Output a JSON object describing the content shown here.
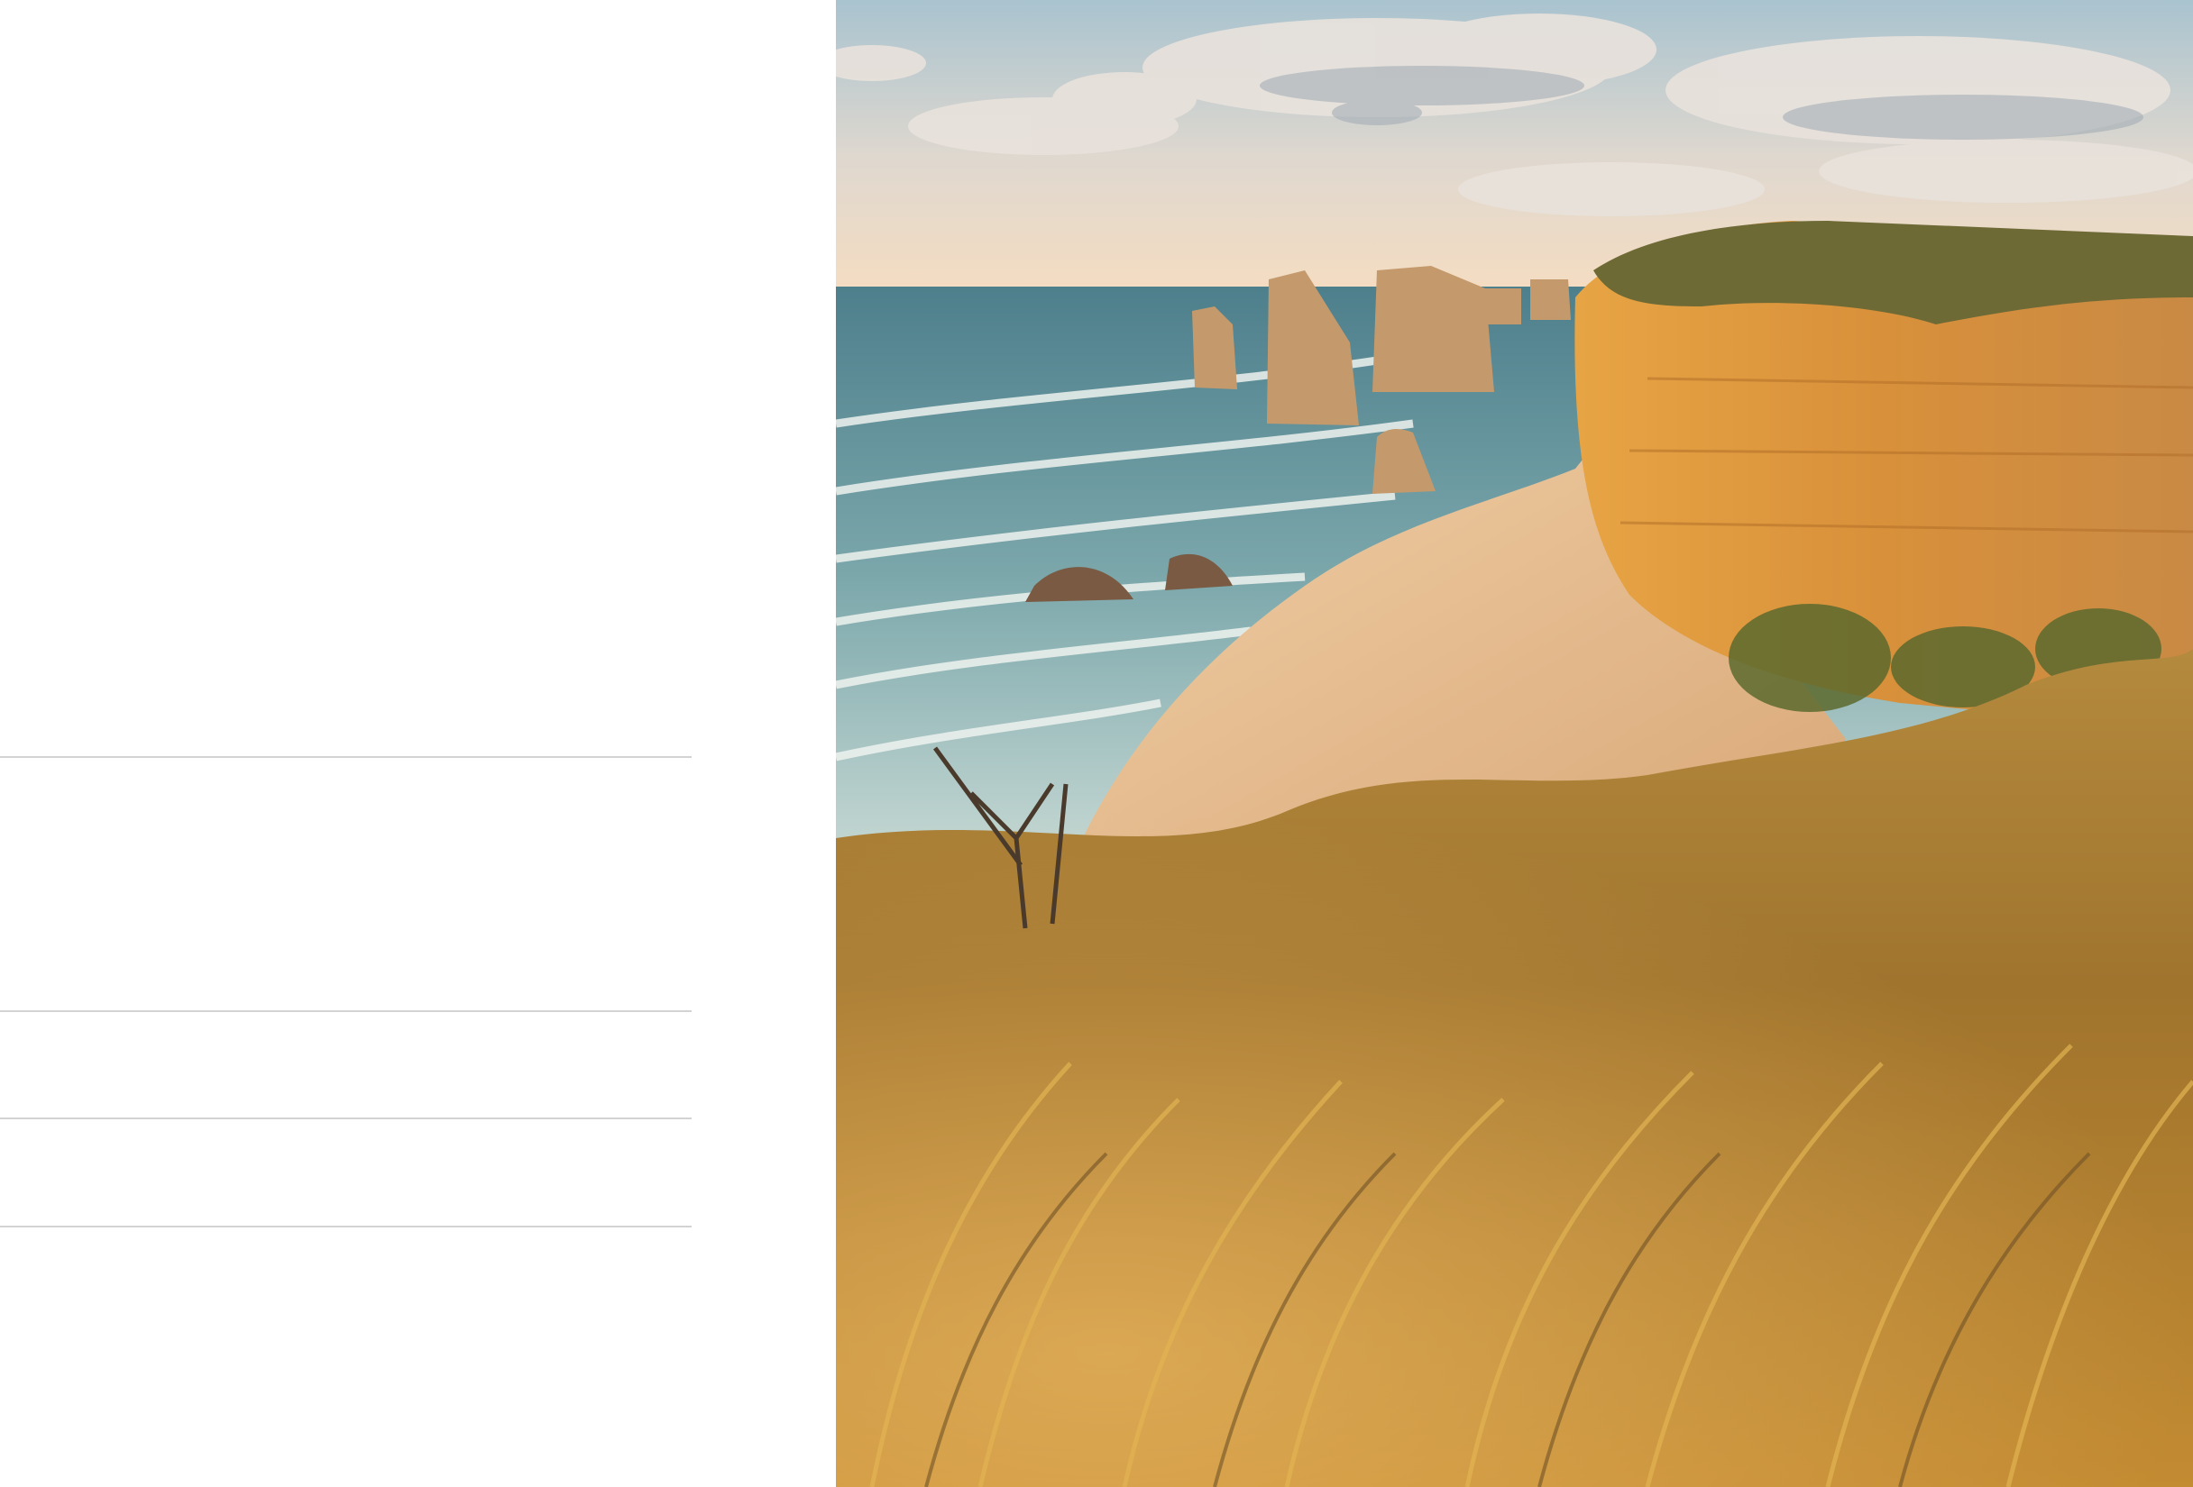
{
  "hero_image": {
    "alt": "",
    "colors": {
      "sky_top": "#a9c3cf",
      "sky_horizon": "#f4dcc2",
      "sea": "#5b8e98",
      "surf": "#e8efe9",
      "sand": "#e2b98e",
      "cliff": "#d9913a",
      "grass": "#b98632"
    }
  }
}
